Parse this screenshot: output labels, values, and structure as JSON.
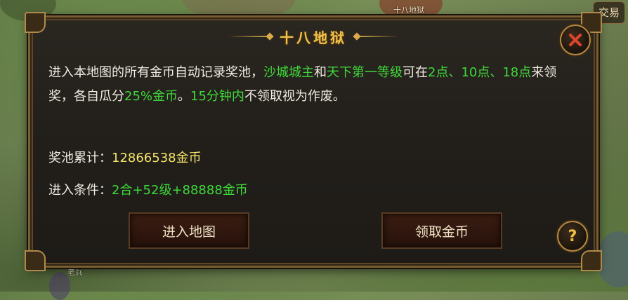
{
  "scene": {
    "top_right_label": "交易",
    "bottom_npc_label": "老兵",
    "top_npc_label": "十八地狱"
  },
  "dialog": {
    "title": "十八地狱",
    "desc": {
      "p1": "进入本地图的所有金币自动记录奖池，",
      "h1": "沙城城主",
      "p2": "和",
      "h2": "天下第一等级",
      "p3": "可在",
      "h3": "2点、10点、18点",
      "p4": "来领奖，各自瓜分",
      "h4": "25%金币",
      "p5": "。",
      "h5": "15分钟内",
      "p6": "不领取视为作废。"
    },
    "pool_label": "奖池累计：",
    "pool_value": "12866538金币",
    "cond_label": "进入条件：",
    "cond_value": "2合+52级+88888金币",
    "enter_button": "进入地图",
    "claim_button": "领取金币",
    "help_button": "?"
  },
  "colors": {
    "accent_gold": "#f2c14e",
    "highlight_green": "#3fd93a",
    "value_yellow": "#f4e46a",
    "close_red": "#e0452c"
  }
}
